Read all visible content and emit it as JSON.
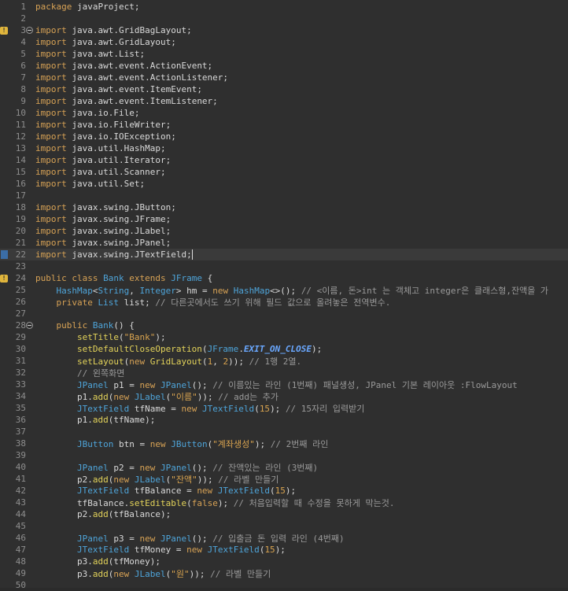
{
  "editor": {
    "lines": [
      {
        "n": "1",
        "segments": [
          {
            "t": "package",
            "c": "kw"
          },
          {
            "t": " javaProject;",
            "c": "plain"
          }
        ]
      },
      {
        "n": "2",
        "segments": []
      },
      {
        "n": "3",
        "marker": "warning",
        "fold": true,
        "segments": [
          {
            "t": "import",
            "c": "kw"
          },
          {
            "t": " java.awt.GridBagLayout;",
            "c": "plain"
          }
        ]
      },
      {
        "n": "4",
        "segments": [
          {
            "t": "import",
            "c": "kw"
          },
          {
            "t": " java.awt.GridLayout;",
            "c": "plain"
          }
        ]
      },
      {
        "n": "5",
        "segments": [
          {
            "t": "import",
            "c": "kw"
          },
          {
            "t": " java.awt.List;",
            "c": "plain"
          }
        ]
      },
      {
        "n": "6",
        "segments": [
          {
            "t": "import",
            "c": "kw"
          },
          {
            "t": " java.awt.event.ActionEvent;",
            "c": "plain"
          }
        ]
      },
      {
        "n": "7",
        "segments": [
          {
            "t": "import",
            "c": "kw"
          },
          {
            "t": " java.awt.event.ActionListener;",
            "c": "plain"
          }
        ]
      },
      {
        "n": "8",
        "segments": [
          {
            "t": "import",
            "c": "kw"
          },
          {
            "t": " java.awt.event.ItemEvent;",
            "c": "plain"
          }
        ]
      },
      {
        "n": "9",
        "segments": [
          {
            "t": "import",
            "c": "kw"
          },
          {
            "t": " java.awt.event.ItemListener;",
            "c": "plain"
          }
        ]
      },
      {
        "n": "10",
        "segments": [
          {
            "t": "import",
            "c": "kw"
          },
          {
            "t": " java.io.File;",
            "c": "plain"
          }
        ]
      },
      {
        "n": "11",
        "segments": [
          {
            "t": "import",
            "c": "kw"
          },
          {
            "t": " java.io.FileWriter;",
            "c": "plain"
          }
        ]
      },
      {
        "n": "12",
        "segments": [
          {
            "t": "import",
            "c": "kw"
          },
          {
            "t": " java.io.IOException;",
            "c": "plain"
          }
        ]
      },
      {
        "n": "13",
        "segments": [
          {
            "t": "import",
            "c": "kw"
          },
          {
            "t": " java.util.HashMap;",
            "c": "plain"
          }
        ]
      },
      {
        "n": "14",
        "segments": [
          {
            "t": "import",
            "c": "kw"
          },
          {
            "t": " java.util.Iterator;",
            "c": "plain"
          }
        ]
      },
      {
        "n": "15",
        "segments": [
          {
            "t": "import",
            "c": "kw"
          },
          {
            "t": " java.util.Scanner;",
            "c": "plain"
          }
        ]
      },
      {
        "n": "16",
        "segments": [
          {
            "t": "import",
            "c": "kw"
          },
          {
            "t": " java.util.Set;",
            "c": "plain"
          }
        ]
      },
      {
        "n": "17",
        "segments": []
      },
      {
        "n": "18",
        "segments": [
          {
            "t": "import",
            "c": "kw"
          },
          {
            "t": " javax.swing.JButton;",
            "c": "plain"
          }
        ]
      },
      {
        "n": "19",
        "segments": [
          {
            "t": "import",
            "c": "kw"
          },
          {
            "t": " javax.swing.JFrame;",
            "c": "plain"
          }
        ]
      },
      {
        "n": "20",
        "segments": [
          {
            "t": "import",
            "c": "kw"
          },
          {
            "t": " javax.swing.JLabel;",
            "c": "plain"
          }
        ]
      },
      {
        "n": "21",
        "segments": [
          {
            "t": "import",
            "c": "kw"
          },
          {
            "t": " javax.swing.JPanel;",
            "c": "plain"
          }
        ]
      },
      {
        "n": "22",
        "marker": "bookmark",
        "current": true,
        "segments": [
          {
            "t": "import",
            "c": "kw"
          },
          {
            "t": " javax.swing.JTextField;",
            "c": "plain"
          }
        ]
      },
      {
        "n": "23",
        "segments": []
      },
      {
        "n": "24",
        "marker": "warning",
        "segments": [
          {
            "t": "public",
            "c": "kw"
          },
          {
            "t": " ",
            "c": "plain"
          },
          {
            "t": "class",
            "c": "kw"
          },
          {
            "t": " ",
            "c": "plain"
          },
          {
            "t": "Bank",
            "c": "ty"
          },
          {
            "t": " ",
            "c": "plain"
          },
          {
            "t": "extends",
            "c": "kw"
          },
          {
            "t": " ",
            "c": "plain"
          },
          {
            "t": "JFrame",
            "c": "ty"
          },
          {
            "t": " {",
            "c": "plain"
          }
        ]
      },
      {
        "n": "25",
        "segments": [
          {
            "t": "    ",
            "c": "plain"
          },
          {
            "t": "HashMap",
            "c": "ty"
          },
          {
            "t": "<",
            "c": "plain"
          },
          {
            "t": "String",
            "c": "ty"
          },
          {
            "t": ", ",
            "c": "plain"
          },
          {
            "t": "Integer",
            "c": "ty"
          },
          {
            "t": "> hm = ",
            "c": "plain"
          },
          {
            "t": "new",
            "c": "kw"
          },
          {
            "t": " ",
            "c": "plain"
          },
          {
            "t": "HashMap",
            "c": "ty"
          },
          {
            "t": "<>(); ",
            "c": "plain"
          },
          {
            "t": "// <이름, 돈>int 는 객체고 integer은 클래스형,잔액을 가",
            "c": "cm"
          }
        ]
      },
      {
        "n": "26",
        "segments": [
          {
            "t": "    ",
            "c": "plain"
          },
          {
            "t": "private",
            "c": "kw"
          },
          {
            "t": " ",
            "c": "plain"
          },
          {
            "t": "List",
            "c": "ty"
          },
          {
            "t": " list; ",
            "c": "plain"
          },
          {
            "t": "// 다른곳에서도 쓰기 위해 필드 값으로 올려놓은 전역변수.",
            "c": "cm"
          }
        ]
      },
      {
        "n": "27",
        "segments": []
      },
      {
        "n": "28",
        "fold": true,
        "segments": [
          {
            "t": "    ",
            "c": "plain"
          },
          {
            "t": "public",
            "c": "kw"
          },
          {
            "t": " ",
            "c": "plain"
          },
          {
            "t": "Bank",
            "c": "ty"
          },
          {
            "t": "() {",
            "c": "plain"
          }
        ]
      },
      {
        "n": "29",
        "segments": [
          {
            "t": "        ",
            "c": "plain"
          },
          {
            "t": "setTitle",
            "c": "fn"
          },
          {
            "t": "(",
            "c": "plain"
          },
          {
            "t": "\"Bank\"",
            "c": "str"
          },
          {
            "t": ");",
            "c": "plain"
          }
        ]
      },
      {
        "n": "30",
        "segments": [
          {
            "t": "        ",
            "c": "plain"
          },
          {
            "t": "setDefaultCloseOperation",
            "c": "fn"
          },
          {
            "t": "(",
            "c": "plain"
          },
          {
            "t": "JFrame",
            "c": "ty"
          },
          {
            "t": ".",
            "c": "plain"
          },
          {
            "t": "EXIT_ON_CLOSE",
            "c": "sf"
          },
          {
            "t": ");",
            "c": "plain"
          }
        ]
      },
      {
        "n": "31",
        "segments": [
          {
            "t": "        ",
            "c": "plain"
          },
          {
            "t": "setLayout",
            "c": "fn"
          },
          {
            "t": "(",
            "c": "plain"
          },
          {
            "t": "new",
            "c": "kw"
          },
          {
            "t": " ",
            "c": "plain"
          },
          {
            "t": "GridLayout",
            "c": "fn"
          },
          {
            "t": "(",
            "c": "plain"
          },
          {
            "t": "1",
            "c": "num"
          },
          {
            "t": ", ",
            "c": "plain"
          },
          {
            "t": "2",
            "c": "num"
          },
          {
            "t": ")); ",
            "c": "plain"
          },
          {
            "t": "// 1행 2열.",
            "c": "cm"
          }
        ]
      },
      {
        "n": "32",
        "segments": [
          {
            "t": "        ",
            "c": "plain"
          },
          {
            "t": "// 왼쪽화면",
            "c": "cm"
          }
        ]
      },
      {
        "n": "33",
        "segments": [
          {
            "t": "        ",
            "c": "plain"
          },
          {
            "t": "JPanel",
            "c": "ty"
          },
          {
            "t": " p1 = ",
            "c": "plain"
          },
          {
            "t": "new",
            "c": "kw"
          },
          {
            "t": " ",
            "c": "plain"
          },
          {
            "t": "JPanel",
            "c": "ty"
          },
          {
            "t": "(); ",
            "c": "plain"
          },
          {
            "t": "// 이름있는 라인 (1번째) 패널생성, JPanel 기본 레이아웃 :FlowLayout",
            "c": "cm"
          }
        ]
      },
      {
        "n": "34",
        "segments": [
          {
            "t": "        p1.",
            "c": "plain"
          },
          {
            "t": "add",
            "c": "fn"
          },
          {
            "t": "(",
            "c": "plain"
          },
          {
            "t": "new",
            "c": "kw"
          },
          {
            "t": " ",
            "c": "plain"
          },
          {
            "t": "JLabel",
            "c": "ty"
          },
          {
            "t": "(",
            "c": "plain"
          },
          {
            "t": "\"이름\"",
            "c": "str"
          },
          {
            "t": ")); ",
            "c": "plain"
          },
          {
            "t": "// add는 추가",
            "c": "cm"
          }
        ]
      },
      {
        "n": "35",
        "segments": [
          {
            "t": "        ",
            "c": "plain"
          },
          {
            "t": "JTextField",
            "c": "ty"
          },
          {
            "t": " tfName = ",
            "c": "plain"
          },
          {
            "t": "new",
            "c": "kw"
          },
          {
            "t": " ",
            "c": "plain"
          },
          {
            "t": "JTextField",
            "c": "ty"
          },
          {
            "t": "(",
            "c": "plain"
          },
          {
            "t": "15",
            "c": "num"
          },
          {
            "t": "); ",
            "c": "plain"
          },
          {
            "t": "// 15자리 입력받기",
            "c": "cm"
          }
        ]
      },
      {
        "n": "36",
        "segments": [
          {
            "t": "        p1.",
            "c": "plain"
          },
          {
            "t": "add",
            "c": "fn"
          },
          {
            "t": "(tfName);",
            "c": "plain"
          }
        ]
      },
      {
        "n": "37",
        "segments": []
      },
      {
        "n": "38",
        "segments": [
          {
            "t": "        ",
            "c": "plain"
          },
          {
            "t": "JButton",
            "c": "ty"
          },
          {
            "t": " btn = ",
            "c": "plain"
          },
          {
            "t": "new",
            "c": "kw"
          },
          {
            "t": " ",
            "c": "plain"
          },
          {
            "t": "JButton",
            "c": "ty"
          },
          {
            "t": "(",
            "c": "plain"
          },
          {
            "t": "\"계좌생성\"",
            "c": "str"
          },
          {
            "t": "); ",
            "c": "plain"
          },
          {
            "t": "// 2번째 라인",
            "c": "cm"
          }
        ]
      },
      {
        "n": "39",
        "segments": []
      },
      {
        "n": "40",
        "segments": [
          {
            "t": "        ",
            "c": "plain"
          },
          {
            "t": "JPanel",
            "c": "ty"
          },
          {
            "t": " p2 = ",
            "c": "plain"
          },
          {
            "t": "new",
            "c": "kw"
          },
          {
            "t": " ",
            "c": "plain"
          },
          {
            "t": "JPanel",
            "c": "ty"
          },
          {
            "t": "(); ",
            "c": "plain"
          },
          {
            "t": "// 잔액있는 라인 (3번째)",
            "c": "cm"
          }
        ]
      },
      {
        "n": "41",
        "segments": [
          {
            "t": "        p2.",
            "c": "plain"
          },
          {
            "t": "add",
            "c": "fn"
          },
          {
            "t": "(",
            "c": "plain"
          },
          {
            "t": "new",
            "c": "kw"
          },
          {
            "t": " ",
            "c": "plain"
          },
          {
            "t": "JLabel",
            "c": "ty"
          },
          {
            "t": "(",
            "c": "plain"
          },
          {
            "t": "\"잔액\"",
            "c": "str"
          },
          {
            "t": ")); ",
            "c": "plain"
          },
          {
            "t": "// 라벨 만들기",
            "c": "cm"
          }
        ]
      },
      {
        "n": "42",
        "segments": [
          {
            "t": "        ",
            "c": "plain"
          },
          {
            "t": "JTextField",
            "c": "ty"
          },
          {
            "t": " tfBalance = ",
            "c": "plain"
          },
          {
            "t": "new",
            "c": "kw"
          },
          {
            "t": " ",
            "c": "plain"
          },
          {
            "t": "JTextField",
            "c": "ty"
          },
          {
            "t": "(",
            "c": "plain"
          },
          {
            "t": "15",
            "c": "num"
          },
          {
            "t": ");",
            "c": "plain"
          }
        ]
      },
      {
        "n": "43",
        "segments": [
          {
            "t": "        tfBalance.",
            "c": "plain"
          },
          {
            "t": "setEditable",
            "c": "fn"
          },
          {
            "t": "(",
            "c": "plain"
          },
          {
            "t": "false",
            "c": "kw"
          },
          {
            "t": "); ",
            "c": "plain"
          },
          {
            "t": "// 처음입력할 때 수정을 못하게 막는것.",
            "c": "cm"
          }
        ]
      },
      {
        "n": "44",
        "segments": [
          {
            "t": "        p2.",
            "c": "plain"
          },
          {
            "t": "add",
            "c": "fn"
          },
          {
            "t": "(tfBalance);",
            "c": "plain"
          }
        ]
      },
      {
        "n": "45",
        "segments": []
      },
      {
        "n": "46",
        "segments": [
          {
            "t": "        ",
            "c": "plain"
          },
          {
            "t": "JPanel",
            "c": "ty"
          },
          {
            "t": " p3 = ",
            "c": "plain"
          },
          {
            "t": "new",
            "c": "kw"
          },
          {
            "t": " ",
            "c": "plain"
          },
          {
            "t": "JPanel",
            "c": "ty"
          },
          {
            "t": "(); ",
            "c": "plain"
          },
          {
            "t": "// 입출금 돈 입력 라인 (4번째)",
            "c": "cm"
          }
        ]
      },
      {
        "n": "47",
        "segments": [
          {
            "t": "        ",
            "c": "plain"
          },
          {
            "t": "JTextField",
            "c": "ty"
          },
          {
            "t": " tfMoney = ",
            "c": "plain"
          },
          {
            "t": "new",
            "c": "kw"
          },
          {
            "t": " ",
            "c": "plain"
          },
          {
            "t": "JTextField",
            "c": "ty"
          },
          {
            "t": "(",
            "c": "plain"
          },
          {
            "t": "15",
            "c": "num"
          },
          {
            "t": ");",
            "c": "plain"
          }
        ]
      },
      {
        "n": "48",
        "segments": [
          {
            "t": "        p3.",
            "c": "plain"
          },
          {
            "t": "add",
            "c": "fn"
          },
          {
            "t": "(tfMoney);",
            "c": "plain"
          }
        ]
      },
      {
        "n": "49",
        "segments": [
          {
            "t": "        p3.",
            "c": "plain"
          },
          {
            "t": "add",
            "c": "fn"
          },
          {
            "t": "(",
            "c": "plain"
          },
          {
            "t": "new",
            "c": "kw"
          },
          {
            "t": " ",
            "c": "plain"
          },
          {
            "t": "JLabel",
            "c": "ty"
          },
          {
            "t": "(",
            "c": "plain"
          },
          {
            "t": "\"원\"",
            "c": "str"
          },
          {
            "t": ")); ",
            "c": "plain"
          },
          {
            "t": "// 라벨 만들기",
            "c": "cm"
          }
        ]
      },
      {
        "n": "50",
        "segments": []
      }
    ]
  },
  "colors": {
    "background": "#2f2f2f",
    "keyword": "#d7a255",
    "type": "#4ea4d9",
    "comment": "#9a9a9a",
    "line_number": "#8e8e8e"
  }
}
